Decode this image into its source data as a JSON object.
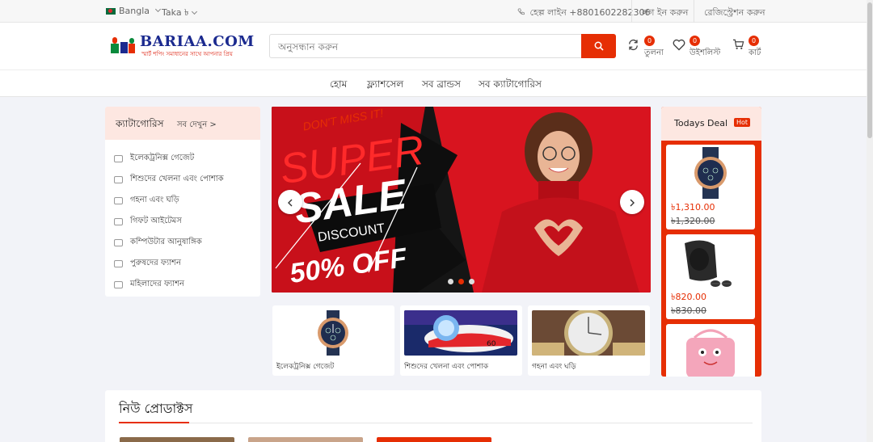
{
  "topbar": {
    "language": "Bangla",
    "currency": "Taka ৳",
    "helpline": "হেল্প লাইন +8801602282306",
    "login": "লগ ইন করুন",
    "register": "রেজিস্ট্রেশন করুন"
  },
  "header": {
    "logo_text": "BARIAA.COM",
    "logo_tagline": "স্মার্ট শপিং সমাধানের সাথে আপনার প্রিয়",
    "search_placeholder": "অনুসন্ধান করুন",
    "compare": {
      "label": "তুলনা",
      "count": "0"
    },
    "wishlist": {
      "label": "উইশলিস্ট",
      "count": "0"
    },
    "cart": {
      "label": "কার্ট",
      "count": "0"
    }
  },
  "nav": {
    "items": [
      "হোম",
      "ফ্ল্যাশসেল",
      "সব ব্রান্ডস",
      "সব ক্যাটাগোরিস"
    ]
  },
  "categories": {
    "title": "ক্যাটাগোরিস",
    "see_all": "সব দেখুন >",
    "items": [
      "ইলেকট্রনিক্স গেজেট",
      "শিশুদের খেলনা এবং পোশাক",
      "গহনা এবং ঘড়ি",
      "গিফট আইটেমস",
      "কম্পিউটার আনুষাঙ্গিক",
      "পুরুষদের ফ্যাশন",
      "মহিলাদের ফ্যাশন"
    ]
  },
  "banner": {
    "line1": "DON'T MISS IT!",
    "line2": "SUPER",
    "line3": "SALE",
    "line4": "DISCOUNT",
    "line5": "50% OFF",
    "active_slide": 2,
    "slide_count": 3
  },
  "category_cards": [
    {
      "label": "ইলেকট্রনিক্স গেজেট",
      "icon": "watch-image"
    },
    {
      "label": "শিশুদের খেলনা এবং পোশাক",
      "icon": "toy-car-image"
    },
    {
      "label": "গহনা এবং ঘড়ি",
      "icon": "watch-image"
    }
  ],
  "todays_deal": {
    "title": "Todays Deal",
    "badge": "Hot",
    "items": [
      {
        "price": "৳1,310.00",
        "old_price": "৳1,320.00",
        "icon": "watch-image"
      },
      {
        "price": "৳820.00",
        "old_price": "৳830.00",
        "icon": "cap-image"
      },
      {
        "price": "",
        "old_price": "",
        "icon": "bag-image"
      }
    ]
  },
  "new_products": {
    "title": "নিউ প্রোডাক্টস"
  },
  "colors": {
    "accent": "#e62e04",
    "logo_blue": "#1b2a8f",
    "soft_pink": "#fde7e1"
  }
}
